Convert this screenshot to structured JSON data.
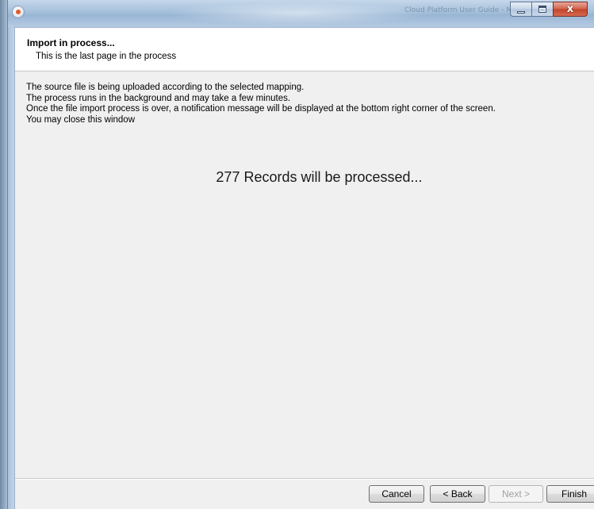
{
  "window": {
    "title": "Cloud Platform User Guide - Microsoft Word",
    "controls": {
      "minimize_icon": "minimize-icon",
      "maximize_icon": "maximize-icon",
      "close_label": "x"
    }
  },
  "header": {
    "title": "Import in process...",
    "subtitle": "This is the last page in the process"
  },
  "body": {
    "lines": [
      "The source file is being uploaded according to the selected mapping.",
      "The process runs in the background and may take a few minutes.",
      "Once the file import process is over, a notification message will be displayed at the bottom right corner of the screen.",
      "You may close this window"
    ],
    "records_message": "277 Records will be processed..."
  },
  "footer": {
    "cancel_label": "Cancel",
    "back_label": "< Back",
    "next_label": "Next >",
    "finish_label": "Finish",
    "next_enabled": false
  },
  "colors": {
    "dialog_background": "#f0f0f0",
    "header_background": "#ffffff",
    "close_button": "#c2422a",
    "titlebar": "#a4bfdb"
  }
}
